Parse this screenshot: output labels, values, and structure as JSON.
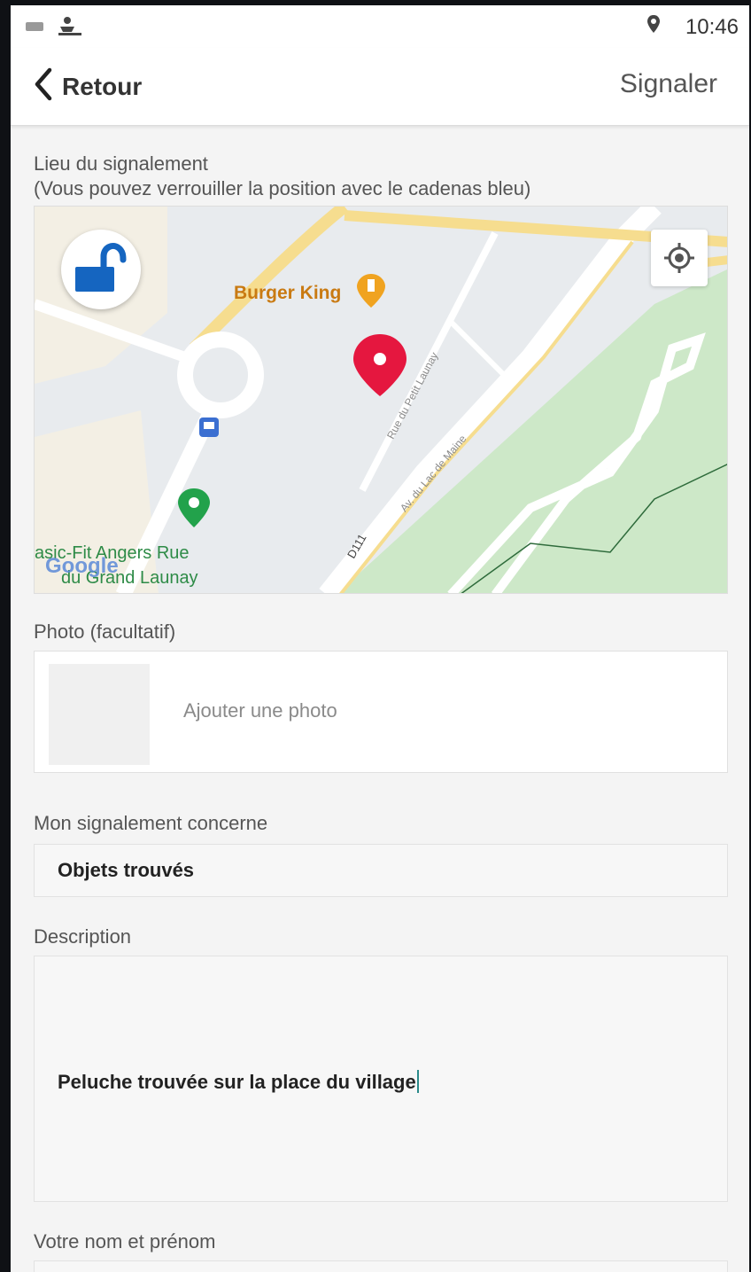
{
  "status_bar": {
    "time": "10:46",
    "icons_left": [
      "mail-icon",
      "boat-icon"
    ],
    "icon_right": "location-icon"
  },
  "nav": {
    "back_label": "Retour",
    "action_label": "Signaler"
  },
  "location": {
    "label": "Lieu du signalement",
    "hint": "(Vous pouvez verrouiller la position avec le cadenas bleu)"
  },
  "map": {
    "poi_burger": "Burger King",
    "street_1": "Rue du Petit Launay",
    "street_2": "Av. du Lac de Maine",
    "road_code": "D111",
    "poi_gym_line1": "asic-Fit Angers Rue",
    "poi_gym_line2": "du Grand Launay",
    "brand": "Google",
    "colors": {
      "park": "#cde8c8",
      "road": "#ffffff",
      "highway": "#f6dd8f",
      "pin": "#e5173f",
      "lock": "#1565c0"
    }
  },
  "photo": {
    "label": "Photo (facultatif)",
    "add_label": "Ajouter une photo"
  },
  "category": {
    "label": "Mon signalement concerne",
    "value": "Objets trouvés"
  },
  "description": {
    "label": "Description",
    "value": "Peluche trouvée sur la place du village"
  },
  "name": {
    "label": "Votre nom et prénom"
  }
}
